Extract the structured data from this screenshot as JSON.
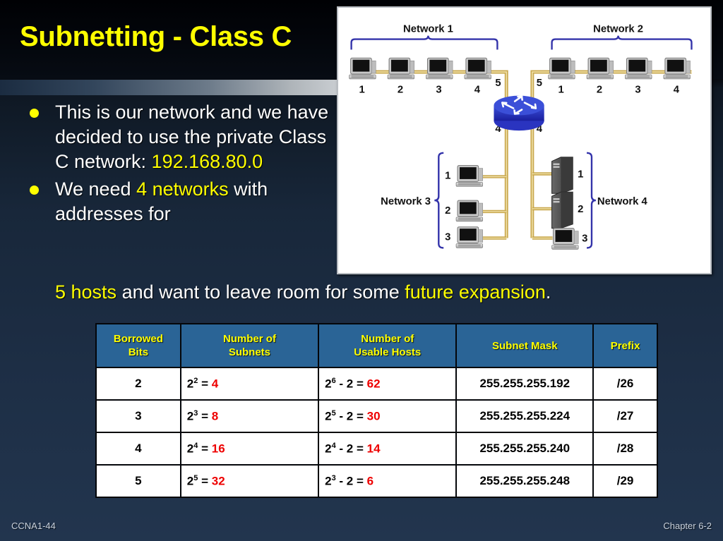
{
  "slide": {
    "title": "Subnetting - Class C",
    "accent_yellow": "#FFFF00",
    "body_white": "#FFFFFF",
    "table_header_blue": "#2a6496",
    "table_value_red": "#EE0000"
  },
  "bullets": [
    {
      "segments": [
        {
          "text": "This is our network and we have decided to use the private Class C network:  ",
          "highlight": false
        },
        {
          "text": "192.168.80.0",
          "highlight": true
        }
      ]
    },
    {
      "segments": [
        {
          "text": "We need ",
          "highlight": false
        },
        {
          "text": "4 networks",
          "highlight": true
        },
        {
          "text": " with addresses for",
          "highlight": false
        }
      ]
    }
  ],
  "trailing_line": {
    "seg1": "5 hosts",
    "seg2": " and want to leave room for some ",
    "seg3": "future expansion",
    "seg4": "."
  },
  "diagram": {
    "alt": "network-topology-diagram",
    "networks": [
      {
        "label": "Network 1",
        "device_numbers": [
          "1",
          "2",
          "3",
          "4"
        ],
        "device_type": "pc"
      },
      {
        "label": "Network 2",
        "device_numbers": [
          "1",
          "2",
          "3",
          "4"
        ],
        "device_type": "pc"
      },
      {
        "label": "Network 3",
        "device_numbers": [
          "1",
          "2",
          "3"
        ],
        "device_type": "pc"
      },
      {
        "label": "Network 4",
        "device_numbers": [
          "1",
          "2",
          "3"
        ],
        "device_type": "server"
      }
    ],
    "router_port_labels": [
      "5",
      "5",
      "4",
      "4"
    ]
  },
  "table": {
    "headers": [
      "Borrowed\nBits",
      "Number of\nSubnets",
      "Number of\nUsable Hosts",
      "Subnet Mask",
      "Prefix"
    ],
    "header_lines": [
      [
        "Borrowed",
        "Bits"
      ],
      [
        "Number of",
        "Subnets"
      ],
      [
        "Number of",
        "Usable Hosts"
      ],
      [
        "Subnet Mask"
      ],
      [
        "Prefix"
      ]
    ],
    "rows": [
      {
        "borrowed_bits": "2",
        "subnets_base": "2",
        "subnets_exp": "2",
        "subnets_eq": " = ",
        "subnets_value": "4",
        "hosts_base": "2",
        "hosts_exp": "6",
        "hosts_minus": " -  2 = ",
        "hosts_value": "62",
        "subnet_mask": "255.255.255.192",
        "prefix": "/26"
      },
      {
        "borrowed_bits": "3",
        "subnets_base": "2",
        "subnets_exp": "3",
        "subnets_eq": " = ",
        "subnets_value": "8",
        "hosts_base": "2",
        "hosts_exp": "5",
        "hosts_minus": " -  2 = ",
        "hosts_value": "30",
        "subnet_mask": "255.255.255.224",
        "prefix": "/27"
      },
      {
        "borrowed_bits": "4",
        "subnets_base": "2",
        "subnets_exp": "4",
        "subnets_eq": " = ",
        "subnets_value": "16",
        "hosts_base": "2",
        "hosts_exp": "4",
        "hosts_minus": " -  2 = ",
        "hosts_value": "14",
        "subnet_mask": "255.255.255.240",
        "prefix": "/28"
      },
      {
        "borrowed_bits": "5",
        "subnets_base": "2",
        "subnets_exp": "5",
        "subnets_eq": " = ",
        "subnets_value": "32",
        "hosts_base": "2",
        "hosts_exp": "3",
        "hosts_minus": " -  2 = ",
        "hosts_value": "6",
        "subnet_mask": "255.255.255.248",
        "prefix": "/29"
      }
    ]
  },
  "footer": {
    "left": "CCNA1-44",
    "right": "Chapter 6-2"
  }
}
